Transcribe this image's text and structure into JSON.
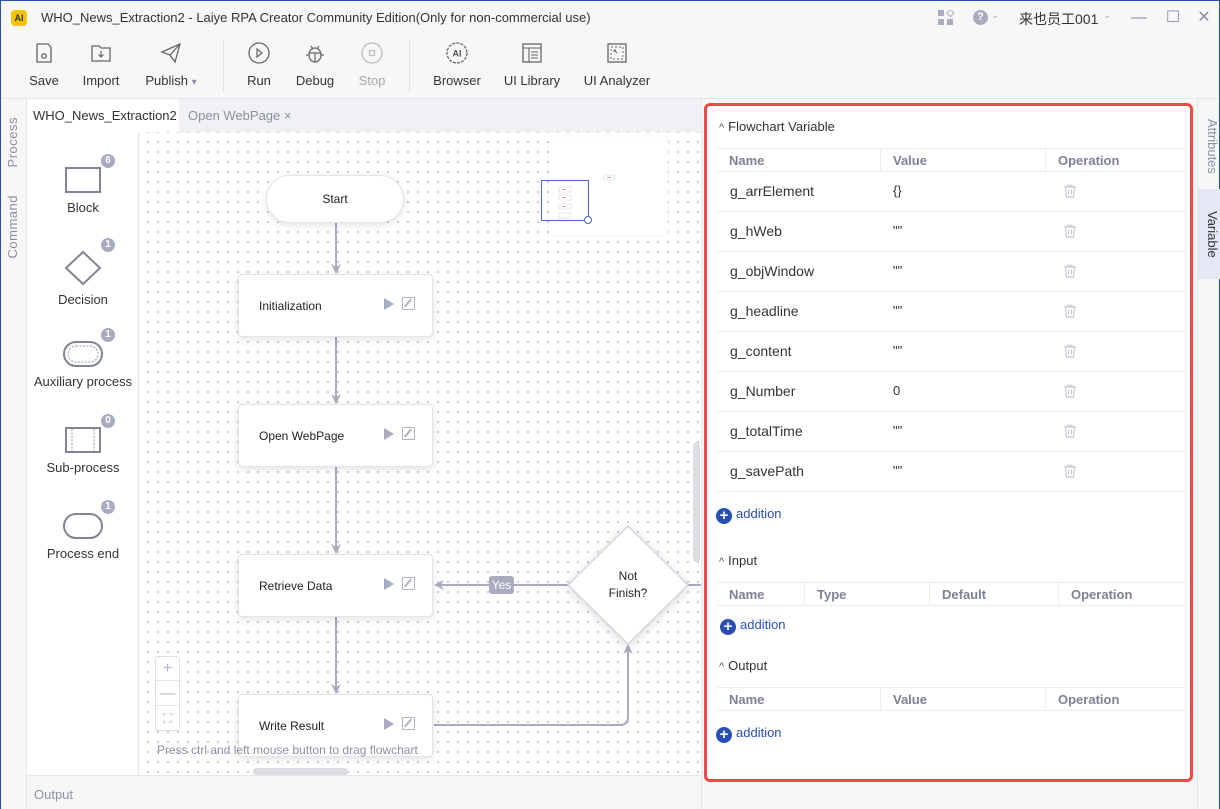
{
  "window": {
    "title": "WHO_News_Extraction2 - Laiye RPA Creator Community Edition(Only for non-commercial use)",
    "logo_text": "AI",
    "user": "来也员工001",
    "help_glyph": "?",
    "chevron": "⌄",
    "controls": {
      "minimize": "—",
      "maximize": "☐",
      "close": "✕"
    }
  },
  "toolbar": {
    "buttons": [
      {
        "label": "Save",
        "icon": "save-icon",
        "enabled": true
      },
      {
        "label": "Import",
        "icon": "import-icon",
        "enabled": true
      },
      {
        "label": "Publish",
        "icon": "publish-icon",
        "enabled": true,
        "has_dropdown": true
      },
      {
        "label": "Run",
        "icon": "run-icon",
        "enabled": true
      },
      {
        "label": "Debug",
        "icon": "debug-icon",
        "enabled": true
      },
      {
        "label": "Stop",
        "icon": "stop-icon",
        "enabled": false
      },
      {
        "label": "Browser",
        "icon": "ai-browser-icon",
        "enabled": true
      },
      {
        "label": "UI Library",
        "icon": "ui-library-icon",
        "enabled": true
      },
      {
        "label": "UI Analyzer",
        "icon": "ui-analyzer-icon",
        "enabled": true
      }
    ],
    "dropdown_glyph": "▾"
  },
  "left_tabs": {
    "process": "Process",
    "command": "Command"
  },
  "doc_tabs": [
    {
      "label": "WHO_News_Extraction2",
      "active": true
    },
    {
      "label": "Open WebPage",
      "active": false,
      "close": "×"
    }
  ],
  "palette": [
    {
      "label": "Block",
      "count": "6",
      "shape": "rect"
    },
    {
      "label": "Decision",
      "count": "1",
      "shape": "diamond"
    },
    {
      "label": "Auxiliary process",
      "count": "1",
      "shape": "double-pill"
    },
    {
      "label": "Sub-process",
      "count": "0",
      "shape": "subprocess"
    },
    {
      "label": "Process end",
      "count": "1",
      "shape": "pill"
    }
  ],
  "flowchart": {
    "start": "Start",
    "blocks": [
      "Initialization",
      "Open WebPage",
      "Retrieve Data",
      "Write Result"
    ],
    "decision": {
      "line1": "Not",
      "line2": "Finish?"
    },
    "yes_label": "Yes",
    "hint": "Press ctrl and left mouse button to drag flowchart",
    "zoom": {
      "in": "+",
      "out": "—",
      "fit": "⛶"
    }
  },
  "bottom": {
    "output": "Output"
  },
  "variables": {
    "flowchart_section": {
      "title": "Flowchart Variable",
      "columns": [
        "Name",
        "Value",
        "Operation"
      ],
      "rows": [
        {
          "name": "g_arrElement",
          "value": "{}"
        },
        {
          "name": "g_hWeb",
          "value": "\"\""
        },
        {
          "name": "g_objWindow",
          "value": "\"\""
        },
        {
          "name": "g_headline",
          "value": "\"\""
        },
        {
          "name": "g_content",
          "value": "\"\""
        },
        {
          "name": "g_Number",
          "value": "0"
        },
        {
          "name": "g_totalTime",
          "value": "\"\""
        },
        {
          "name": "g_savePath",
          "value": "\"\""
        }
      ],
      "add_label": "addition"
    },
    "input_section": {
      "title": "Input",
      "columns": [
        "Name",
        "Type",
        "Default",
        "Operation"
      ],
      "add_label": "addition"
    },
    "output_section": {
      "title": "Output",
      "columns": [
        "Name",
        "Value",
        "Operation"
      ],
      "add_label": "addition"
    },
    "caret": "^",
    "plus": "+"
  },
  "right_tabs": {
    "attributes": "Attributes",
    "variable": "Variable"
  },
  "colors": {
    "accent": "#2a4fb4",
    "highlight_border": "#f04848",
    "muted": "#a8acc0"
  }
}
